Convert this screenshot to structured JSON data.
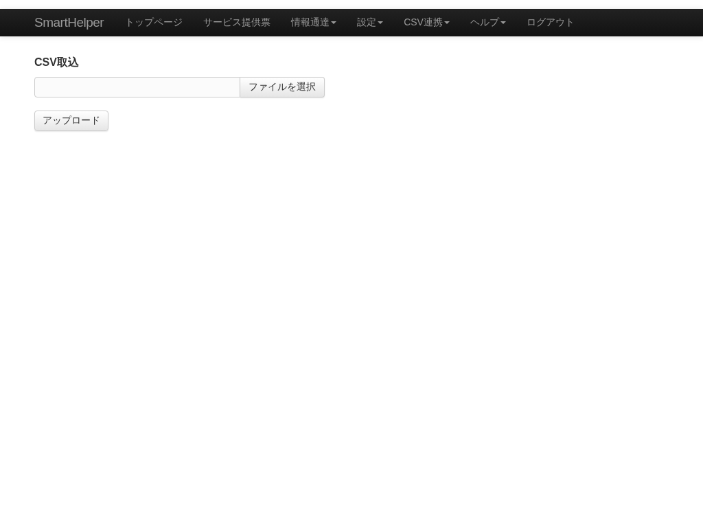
{
  "navbar": {
    "brand": "SmartHelper",
    "items": [
      {
        "label": "トップページ",
        "dropdown": false
      },
      {
        "label": "サービス提供票",
        "dropdown": false
      },
      {
        "label": "情報通達",
        "dropdown": true
      },
      {
        "label": "設定",
        "dropdown": true
      },
      {
        "label": "CSV連携",
        "dropdown": true
      },
      {
        "label": "ヘルプ",
        "dropdown": true
      },
      {
        "label": "ログアウト",
        "dropdown": false
      }
    ]
  },
  "form": {
    "heading": "CSV取込",
    "file_button": "ファイルを選択",
    "submit_button": "アップロード"
  }
}
